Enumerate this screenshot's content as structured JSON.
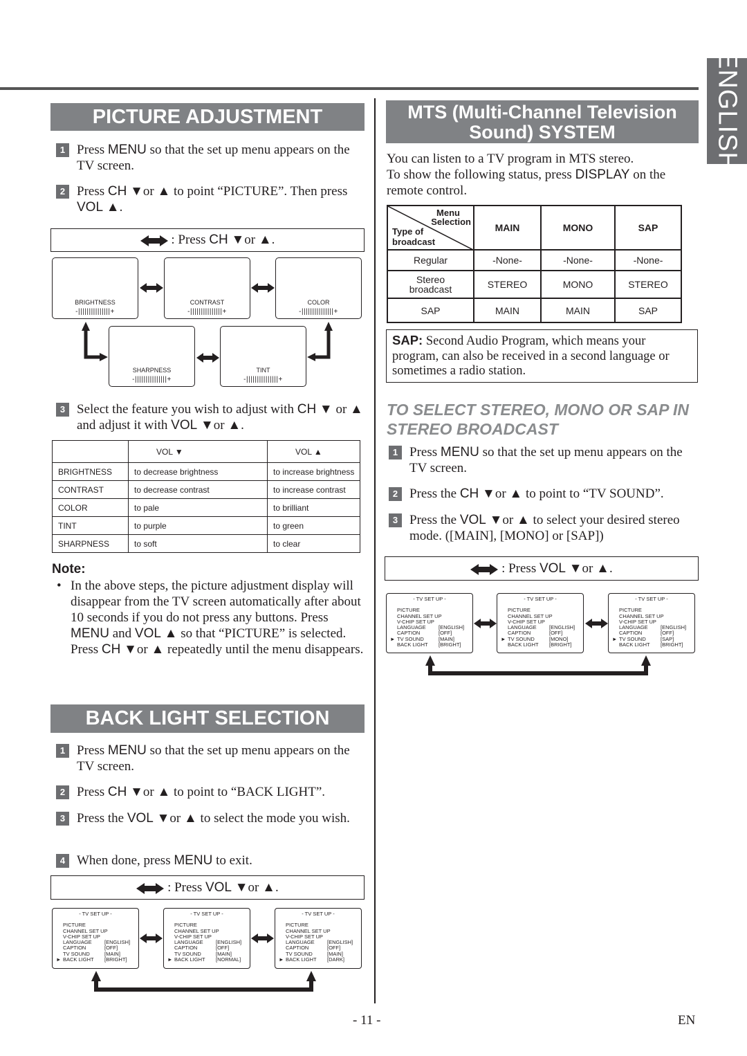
{
  "side_tab": "ENGLISH",
  "picture_adjustment": {
    "title": "PICTURE ADJUSTMENT",
    "steps": [
      {
        "num": "1",
        "pre": "Press ",
        "key": "MENU",
        "post": " so that the set up menu appears on the TV screen."
      },
      {
        "num": "2",
        "pre": "Press ",
        "key": "CH",
        "mid": " ▼or ▲ to point “PICTURE”. Then press ",
        "key2": "VOL",
        "post": " ▲."
      },
      {
        "num": "3",
        "pre": "Select the feature you wish to adjust with ",
        "key": "CH",
        "mid": " ▼ or ▲ and adjust it with ",
        "key2": "VOL",
        "post": " ▼or ▲."
      }
    ],
    "hint": {
      "pre": ": Press ",
      "key": "CH",
      "post": " ▼or ▲."
    },
    "screens": [
      {
        "label": "BRIGHTNESS",
        "slider": "-|||||||||||||||+"
      },
      {
        "label": "CONTRAST",
        "slider": "-|||||||||||||||+"
      },
      {
        "label": "COLOR",
        "slider": "-|||||||||||||||+"
      },
      {
        "label": "SHARPNESS",
        "slider": "-|||||||||||||||+"
      },
      {
        "label": "TINT",
        "slider": "-|||||||||||||||+"
      }
    ],
    "table": {
      "headers": [
        "",
        "VOL ▼",
        "VOL ▲"
      ],
      "rows": [
        [
          "BRIGHTNESS",
          "to decrease brightness",
          "to increase brightness"
        ],
        [
          "CONTRAST",
          "to decrease contrast",
          "to increase contrast"
        ],
        [
          "COLOR",
          "to pale",
          "to brilliant"
        ],
        [
          "TINT",
          "to purple",
          "to green"
        ],
        [
          "SHARPNESS",
          "to soft",
          "to clear"
        ]
      ]
    },
    "note": {
      "heading": "Note:",
      "bullet": "•",
      "t1": "In the above steps, the picture adjustment display will disappear from the TV screen automatically after about 10 seconds if you do not press any buttons. Press ",
      "k1": "MENU",
      "t2": " and ",
      "k2": "VOL",
      "t3": " ▲ so that “PICTURE” is selected. Press ",
      "k3": "CH",
      "t4": " ▼or ▲ repeatedly until the menu disappears."
    }
  },
  "back_light": {
    "title": "BACK LIGHT SELECTION",
    "steps": [
      {
        "num": "1",
        "pre": "Press ",
        "key": "MENU",
        "post": " so that the set up menu appears on the TV screen."
      },
      {
        "num": "2",
        "pre": "Press ",
        "key": "CH",
        "post": " ▼or ▲ to point to “BACK LIGHT”."
      },
      {
        "num": "3",
        "pre": "Press the ",
        "key": "VOL",
        "post": " ▼or ▲ to select the mode you wish."
      },
      {
        "num": "4",
        "pre": "When done, press ",
        "key": "MENU",
        "post": " to exit."
      }
    ],
    "hint": {
      "pre": ": Press ",
      "key": "VOL",
      "post": " ▼or ▲."
    },
    "menus": [
      {
        "back_light": "[BRIGHT]"
      },
      {
        "back_light": "[NORMAL]"
      },
      {
        "back_light": "[DARK]"
      }
    ]
  },
  "menu_common": {
    "title": "- TV SET UP -",
    "picture": "PICTURE",
    "channel": "CHANNEL SET UP",
    "vchip": "V-CHIP SET UP",
    "language": "LANGUAGE",
    "language_val": "[ENGLISH]",
    "caption": "CAPTION",
    "caption_val": "[OFF]",
    "tv_sound": "TV SOUND",
    "back_light": "BACK LIGHT",
    "pointer": "►"
  },
  "mts": {
    "title_line1": "MTS (Multi-Channel Television",
    "title_line2": "Sound) SYSTEM",
    "intro1": "You can listen to a TV program in MTS stereo.",
    "intro2_pre": "To show the following status, press ",
    "intro2_key": "DISPLAY",
    "intro2_post": " on the remote control.",
    "table": {
      "corner_top1": "Menu",
      "corner_top2": "Selection",
      "corner_bottom1": "Type of",
      "corner_bottom2": "broadcast",
      "headers": [
        "MAIN",
        "MONO",
        "SAP"
      ],
      "rows": [
        {
          "type": "Regular",
          "values": [
            "-None-",
            "-None-",
            "-None-"
          ]
        },
        {
          "type": "Stereo broadcast",
          "values": [
            "STEREO",
            "MONO",
            "STEREO"
          ]
        },
        {
          "type": "SAP",
          "values": [
            "MAIN",
            "MAIN",
            "SAP"
          ]
        }
      ]
    },
    "sap_note": {
      "label": "SAP:",
      "text": " Second Audio Program, which means your program, can also be received in a second language or sometimes a radio station."
    },
    "subheading": "TO SELECT STEREO, MONO OR SAP IN STEREO BROADCAST",
    "steps": [
      {
        "num": "1",
        "pre": "Press ",
        "key": "MENU",
        "post": " so that the set up menu appears on the TV screen."
      },
      {
        "num": "2",
        "pre": "Press the ",
        "key": "CH",
        "post": " ▼or ▲ to point to “TV SOUND”."
      },
      {
        "num": "3",
        "pre": "Press the ",
        "key": "VOL",
        "post": " ▼or ▲ to select your desired stereo mode. ([MAIN], [MONO] or [SAP])"
      }
    ],
    "hint": {
      "pre": ": Press ",
      "key": "VOL",
      "post": " ▼or ▲."
    },
    "menus": [
      {
        "tv_sound": "[MAIN]"
      },
      {
        "tv_sound": "[MONO]"
      },
      {
        "tv_sound": "[SAP]"
      }
    ]
  },
  "footer": {
    "page": "- 11 -",
    "lang": "EN"
  }
}
